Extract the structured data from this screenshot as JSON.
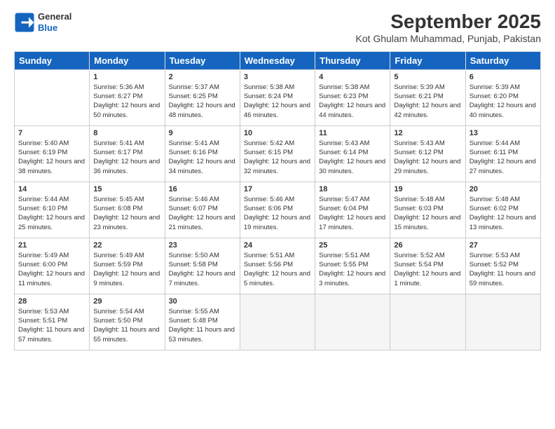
{
  "header": {
    "logo_line1": "General",
    "logo_line2": "Blue",
    "title": "September 2025",
    "subtitle": "Kot Ghulam Muhammad, Punjab, Pakistan"
  },
  "days_of_week": [
    "Sunday",
    "Monday",
    "Tuesday",
    "Wednesday",
    "Thursday",
    "Friday",
    "Saturday"
  ],
  "weeks": [
    [
      {
        "day": "",
        "sunrise": "",
        "sunset": "",
        "daylight": ""
      },
      {
        "day": "1",
        "sunrise": "Sunrise: 5:36 AM",
        "sunset": "Sunset: 6:27 PM",
        "daylight": "Daylight: 12 hours and 50 minutes."
      },
      {
        "day": "2",
        "sunrise": "Sunrise: 5:37 AM",
        "sunset": "Sunset: 6:25 PM",
        "daylight": "Daylight: 12 hours and 48 minutes."
      },
      {
        "day": "3",
        "sunrise": "Sunrise: 5:38 AM",
        "sunset": "Sunset: 6:24 PM",
        "daylight": "Daylight: 12 hours and 46 minutes."
      },
      {
        "day": "4",
        "sunrise": "Sunrise: 5:38 AM",
        "sunset": "Sunset: 6:23 PM",
        "daylight": "Daylight: 12 hours and 44 minutes."
      },
      {
        "day": "5",
        "sunrise": "Sunrise: 5:39 AM",
        "sunset": "Sunset: 6:21 PM",
        "daylight": "Daylight: 12 hours and 42 minutes."
      },
      {
        "day": "6",
        "sunrise": "Sunrise: 5:39 AM",
        "sunset": "Sunset: 6:20 PM",
        "daylight": "Daylight: 12 hours and 40 minutes."
      }
    ],
    [
      {
        "day": "7",
        "sunrise": "Sunrise: 5:40 AM",
        "sunset": "Sunset: 6:19 PM",
        "daylight": "Daylight: 12 hours and 38 minutes."
      },
      {
        "day": "8",
        "sunrise": "Sunrise: 5:41 AM",
        "sunset": "Sunset: 6:17 PM",
        "daylight": "Daylight: 12 hours and 36 minutes."
      },
      {
        "day": "9",
        "sunrise": "Sunrise: 5:41 AM",
        "sunset": "Sunset: 6:16 PM",
        "daylight": "Daylight: 12 hours and 34 minutes."
      },
      {
        "day": "10",
        "sunrise": "Sunrise: 5:42 AM",
        "sunset": "Sunset: 6:15 PM",
        "daylight": "Daylight: 12 hours and 32 minutes."
      },
      {
        "day": "11",
        "sunrise": "Sunrise: 5:43 AM",
        "sunset": "Sunset: 6:14 PM",
        "daylight": "Daylight: 12 hours and 30 minutes."
      },
      {
        "day": "12",
        "sunrise": "Sunrise: 5:43 AM",
        "sunset": "Sunset: 6:12 PM",
        "daylight": "Daylight: 12 hours and 29 minutes."
      },
      {
        "day": "13",
        "sunrise": "Sunrise: 5:44 AM",
        "sunset": "Sunset: 6:11 PM",
        "daylight": "Daylight: 12 hours and 27 minutes."
      }
    ],
    [
      {
        "day": "14",
        "sunrise": "Sunrise: 5:44 AM",
        "sunset": "Sunset: 6:10 PM",
        "daylight": "Daylight: 12 hours and 25 minutes."
      },
      {
        "day": "15",
        "sunrise": "Sunrise: 5:45 AM",
        "sunset": "Sunset: 6:08 PM",
        "daylight": "Daylight: 12 hours and 23 minutes."
      },
      {
        "day": "16",
        "sunrise": "Sunrise: 5:46 AM",
        "sunset": "Sunset: 6:07 PM",
        "daylight": "Daylight: 12 hours and 21 minutes."
      },
      {
        "day": "17",
        "sunrise": "Sunrise: 5:46 AM",
        "sunset": "Sunset: 6:06 PM",
        "daylight": "Daylight: 12 hours and 19 minutes."
      },
      {
        "day": "18",
        "sunrise": "Sunrise: 5:47 AM",
        "sunset": "Sunset: 6:04 PM",
        "daylight": "Daylight: 12 hours and 17 minutes."
      },
      {
        "day": "19",
        "sunrise": "Sunrise: 5:48 AM",
        "sunset": "Sunset: 6:03 PM",
        "daylight": "Daylight: 12 hours and 15 minutes."
      },
      {
        "day": "20",
        "sunrise": "Sunrise: 5:48 AM",
        "sunset": "Sunset: 6:02 PM",
        "daylight": "Daylight: 12 hours and 13 minutes."
      }
    ],
    [
      {
        "day": "21",
        "sunrise": "Sunrise: 5:49 AM",
        "sunset": "Sunset: 6:00 PM",
        "daylight": "Daylight: 12 hours and 11 minutes."
      },
      {
        "day": "22",
        "sunrise": "Sunrise: 5:49 AM",
        "sunset": "Sunset: 5:59 PM",
        "daylight": "Daylight: 12 hours and 9 minutes."
      },
      {
        "day": "23",
        "sunrise": "Sunrise: 5:50 AM",
        "sunset": "Sunset: 5:58 PM",
        "daylight": "Daylight: 12 hours and 7 minutes."
      },
      {
        "day": "24",
        "sunrise": "Sunrise: 5:51 AM",
        "sunset": "Sunset: 5:56 PM",
        "daylight": "Daylight: 12 hours and 5 minutes."
      },
      {
        "day": "25",
        "sunrise": "Sunrise: 5:51 AM",
        "sunset": "Sunset: 5:55 PM",
        "daylight": "Daylight: 12 hours and 3 minutes."
      },
      {
        "day": "26",
        "sunrise": "Sunrise: 5:52 AM",
        "sunset": "Sunset: 5:54 PM",
        "daylight": "Daylight: 12 hours and 1 minute."
      },
      {
        "day": "27",
        "sunrise": "Sunrise: 5:53 AM",
        "sunset": "Sunset: 5:52 PM",
        "daylight": "Daylight: 11 hours and 59 minutes."
      }
    ],
    [
      {
        "day": "28",
        "sunrise": "Sunrise: 5:53 AM",
        "sunset": "Sunset: 5:51 PM",
        "daylight": "Daylight: 11 hours and 57 minutes."
      },
      {
        "day": "29",
        "sunrise": "Sunrise: 5:54 AM",
        "sunset": "Sunset: 5:50 PM",
        "daylight": "Daylight: 11 hours and 55 minutes."
      },
      {
        "day": "30",
        "sunrise": "Sunrise: 5:55 AM",
        "sunset": "Sunset: 5:48 PM",
        "daylight": "Daylight: 11 hours and 53 minutes."
      },
      {
        "day": "",
        "sunrise": "",
        "sunset": "",
        "daylight": ""
      },
      {
        "day": "",
        "sunrise": "",
        "sunset": "",
        "daylight": ""
      },
      {
        "day": "",
        "sunrise": "",
        "sunset": "",
        "daylight": ""
      },
      {
        "day": "",
        "sunrise": "",
        "sunset": "",
        "daylight": ""
      }
    ]
  ]
}
